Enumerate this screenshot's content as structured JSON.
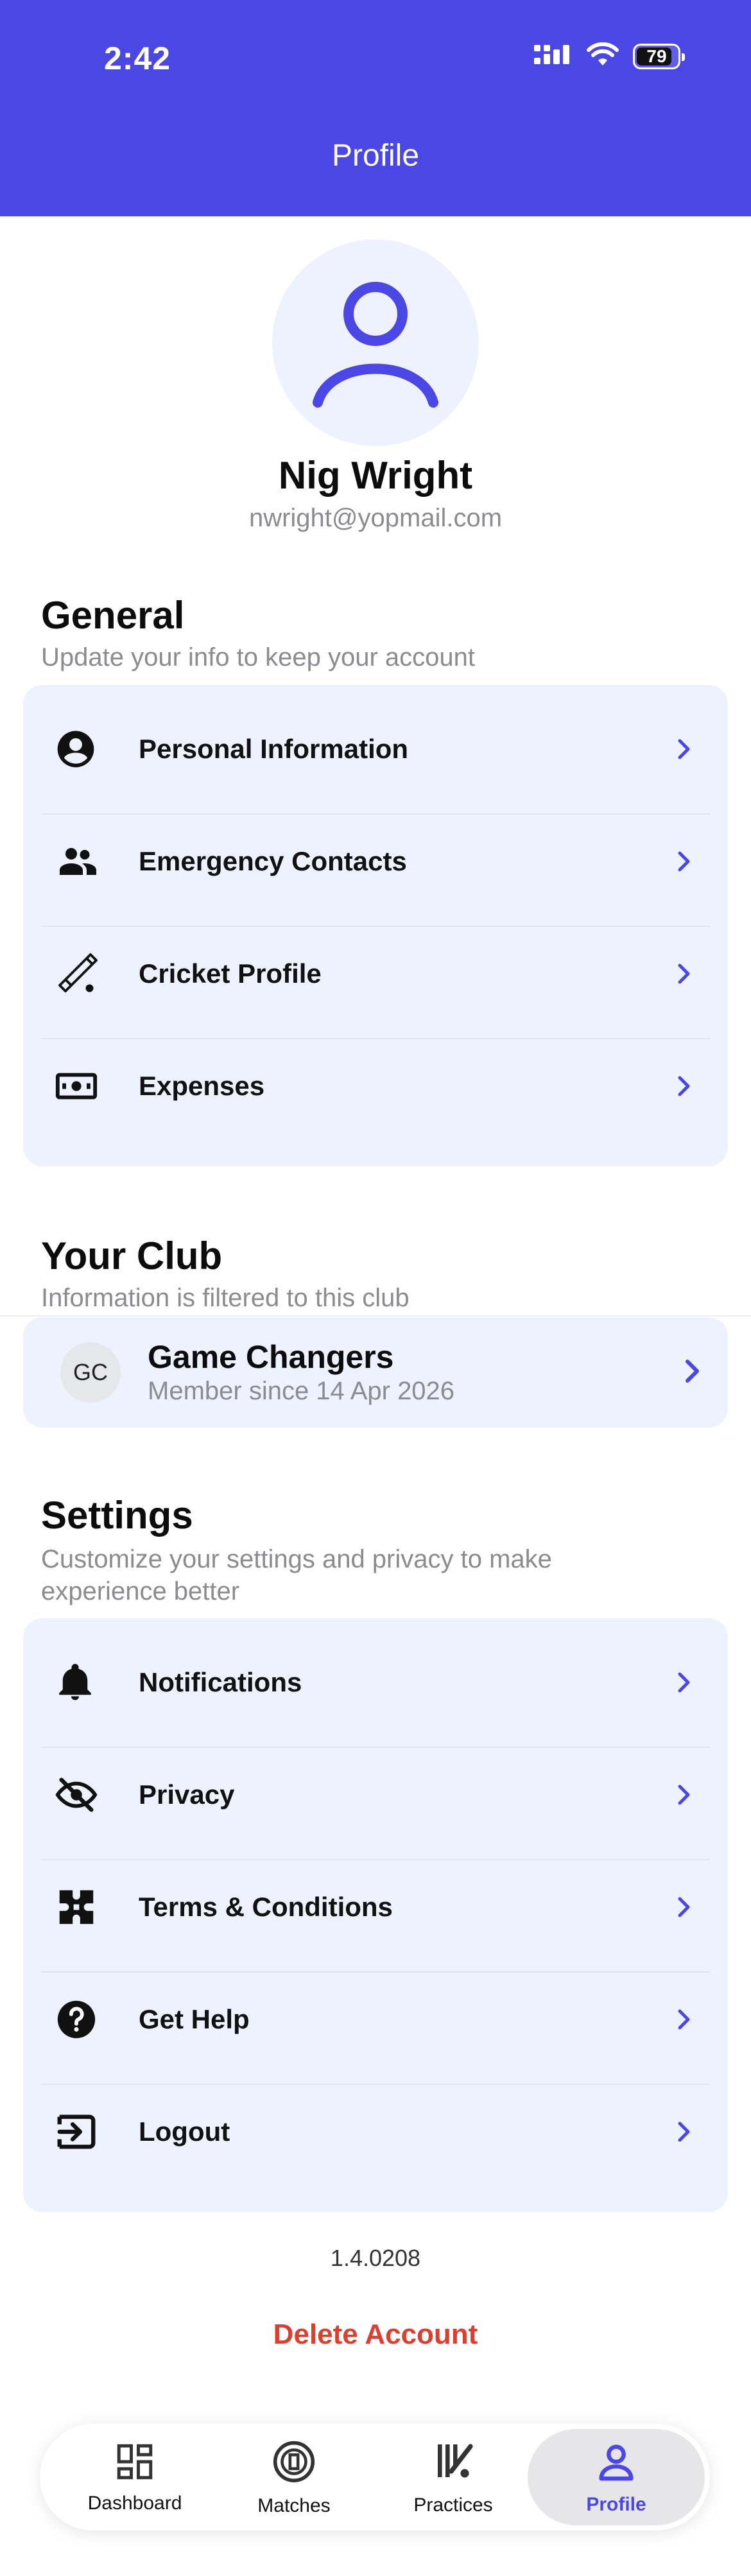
{
  "status_bar": {
    "time": "2:42",
    "battery": "79"
  },
  "header": {
    "title": "Profile"
  },
  "profile": {
    "name": "Nig Wright",
    "email": "nwright@yopmail.com"
  },
  "general": {
    "title": "General",
    "subtitle": "Update your info to keep your account",
    "items": [
      {
        "label": "Personal Information",
        "icon": "account-circle-icon"
      },
      {
        "label": "Emergency Contacts",
        "icon": "people-icon"
      },
      {
        "label": "Cricket Profile",
        "icon": "cricket-bat-icon"
      },
      {
        "label": "Expenses",
        "icon": "money-icon"
      }
    ]
  },
  "club": {
    "title": "Your Club",
    "subtitle": "Information is filtered to this club",
    "badge": "GC",
    "name": "Game Changers",
    "since": "Member since 14 Apr 2026"
  },
  "settings": {
    "title": "Settings",
    "subtitle": "Customize your settings and privacy to make experience better",
    "items": [
      {
        "label": "Notifications",
        "icon": "bell-icon"
      },
      {
        "label": "Privacy",
        "icon": "eye-off-icon"
      },
      {
        "label": "Terms & Conditions",
        "icon": "puzzle-icon"
      },
      {
        "label": "Get Help",
        "icon": "help-icon"
      },
      {
        "label": "Logout",
        "icon": "logout-icon"
      }
    ]
  },
  "footer": {
    "version": "1.4.0208",
    "delete_label": "Delete Account"
  },
  "tabs": [
    {
      "label": "Dashboard",
      "icon": "dashboard-icon"
    },
    {
      "label": "Matches",
      "icon": "matches-icon"
    },
    {
      "label": "Practices",
      "icon": "practices-icon"
    },
    {
      "label": "Profile",
      "icon": "profile-icon",
      "active": true
    }
  ],
  "colors": {
    "accent": "#4a47e4",
    "card": "#eef2ff",
    "danger": "#d9402f",
    "muted": "#8b8b90"
  }
}
